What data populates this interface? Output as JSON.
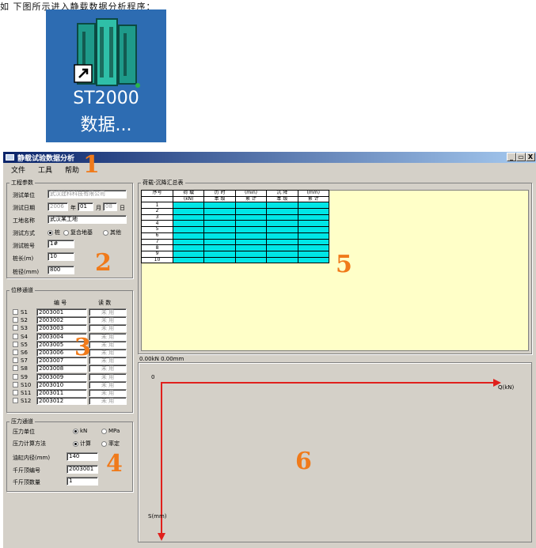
{
  "caption": "如  下图所示进入静载数据分析程序：",
  "desktop_icon": {
    "label_line1": "ST2000",
    "label_line2": "数据..."
  },
  "window": {
    "title": "静载试验数据分析",
    "min": "_",
    "max": "▭",
    "close": "X"
  },
  "menu": [
    "文件",
    "工具",
    "帮助"
  ],
  "markers": [
    "1",
    "2",
    "3",
    "4",
    "5",
    "6"
  ],
  "project": {
    "legend": "工程参数",
    "unit_label": "测试单位",
    "unit_value": "武汉建科科技有限公司",
    "date_label": "测试日期",
    "date_year": "2006",
    "date_year_suffix": "年",
    "date_month": "01",
    "date_month_suffix": "月",
    "date_day": "08",
    "date_day_suffix": "日",
    "site_label": "工地名称",
    "site_value": "武汉某工地",
    "method_label": "测试方式",
    "method_options": [
      "桩",
      "复合地基",
      "其他"
    ],
    "pile_no_label": "测试桩号",
    "pile_no_value": "1#",
    "length_label": "桩长(m)",
    "length_value": "10",
    "diameter_label": "桩径(mm)",
    "diameter_value": "800"
  },
  "displacement": {
    "legend": "位移通道",
    "col_no": "编  号",
    "col_reading": "读  数",
    "channels": [
      {
        "name": "S1",
        "id": "2003001",
        "reading": "未 用"
      },
      {
        "name": "S2",
        "id": "2003002",
        "reading": "未 用"
      },
      {
        "name": "S3",
        "id": "2003003",
        "reading": "未 用"
      },
      {
        "name": "S4",
        "id": "2003004",
        "reading": "未 用"
      },
      {
        "name": "S5",
        "id": "2003005",
        "reading": "未 用"
      },
      {
        "name": "S6",
        "id": "2003006",
        "reading": "未 用"
      },
      {
        "name": "S7",
        "id": "2003007",
        "reading": "未 用"
      },
      {
        "name": "S8",
        "id": "2003008",
        "reading": "未 用"
      },
      {
        "name": "S9",
        "id": "2003009",
        "reading": "未 用"
      },
      {
        "name": "S10",
        "id": "2003010",
        "reading": "未 用"
      },
      {
        "name": "S11",
        "id": "2003011",
        "reading": "未 用"
      },
      {
        "name": "S12",
        "id": "2003012",
        "reading": "未 用"
      }
    ]
  },
  "pressure": {
    "legend": "压力通道",
    "unit_label": "压力单位",
    "unit_options": [
      "kN",
      "MPa"
    ],
    "calc_label": "压力计算方法",
    "calc_options": [
      "计算",
      "率定"
    ],
    "cyl_label": "油缸内径(mm)",
    "cyl_value": "140",
    "jack_no_label": "千斤顶编号",
    "jack_no_value": "2003001",
    "jack_count_label": "千斤顶数量",
    "jack_count_value": "1"
  },
  "summary": {
    "legend": "荷载-沉降汇总表",
    "headers_top": [
      "序号",
      "荷 载",
      "历 时",
      "(min)",
      "沉 降",
      "(mm)"
    ],
    "headers_bottom": [
      "(kN)",
      "本 级",
      "累 计",
      "本 级",
      "累 计"
    ],
    "rows": [
      "1",
      "2",
      "3",
      "4",
      "5",
      "6",
      "7",
      "8",
      "9",
      "10"
    ]
  },
  "graph": {
    "readout": "0.00kN   0.00mm",
    "origin_label": "0",
    "x_label": "Q(kN)",
    "y_label": "S(mm)",
    "axis_color": "#e0201c"
  },
  "colors": {
    "marker": "#f07a1a",
    "cell": "#00e6e6",
    "panel": "#ffffc8",
    "title_bar": "#0a246a",
    "icon_bg": "#2d6cb2"
  }
}
